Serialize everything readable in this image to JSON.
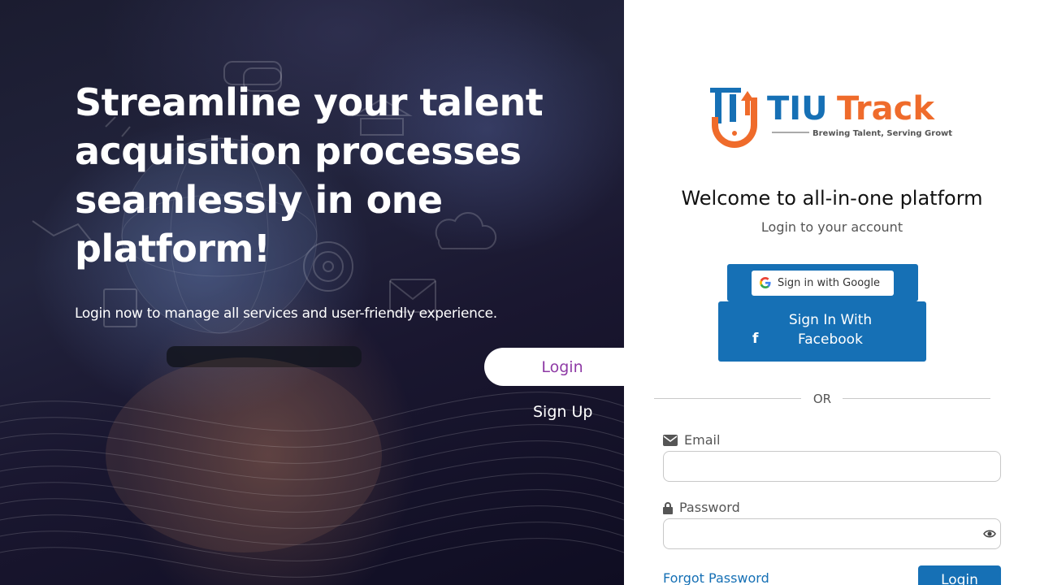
{
  "hero": {
    "title": "Streamline your talent acquisition processes seamlessly in one platform!",
    "subtitle": "Login now to manage all services and user-friendly experience.",
    "tabs": {
      "login": "Login",
      "signup": "Sign Up"
    }
  },
  "brand": {
    "name_part1": "TIU",
    "name_part2": "Track",
    "tagline": "Brewing Talent, Serving Growth",
    "colors": {
      "blue": "#1670b5",
      "orange": "#ef6b2b"
    }
  },
  "login": {
    "welcome": "Welcome to all-in-one platform",
    "subtitle": "Login to your account",
    "google_label": "Sign in with Google",
    "facebook_label": "Sign In With Facebook",
    "or_label": "OR",
    "email_label": "Email",
    "email_value": "",
    "password_label": "Password",
    "password_value": "",
    "forgot_label": "Forgot Password",
    "submit_label": "Login"
  },
  "icons": {
    "google": "google-g-icon",
    "facebook": "facebook-f-icon",
    "email": "envelope-icon",
    "password": "lock-icon",
    "reveal": "eye-icon"
  },
  "colors": {
    "accent": "#1670b5",
    "tab_active_text": "#8e3aa5"
  }
}
